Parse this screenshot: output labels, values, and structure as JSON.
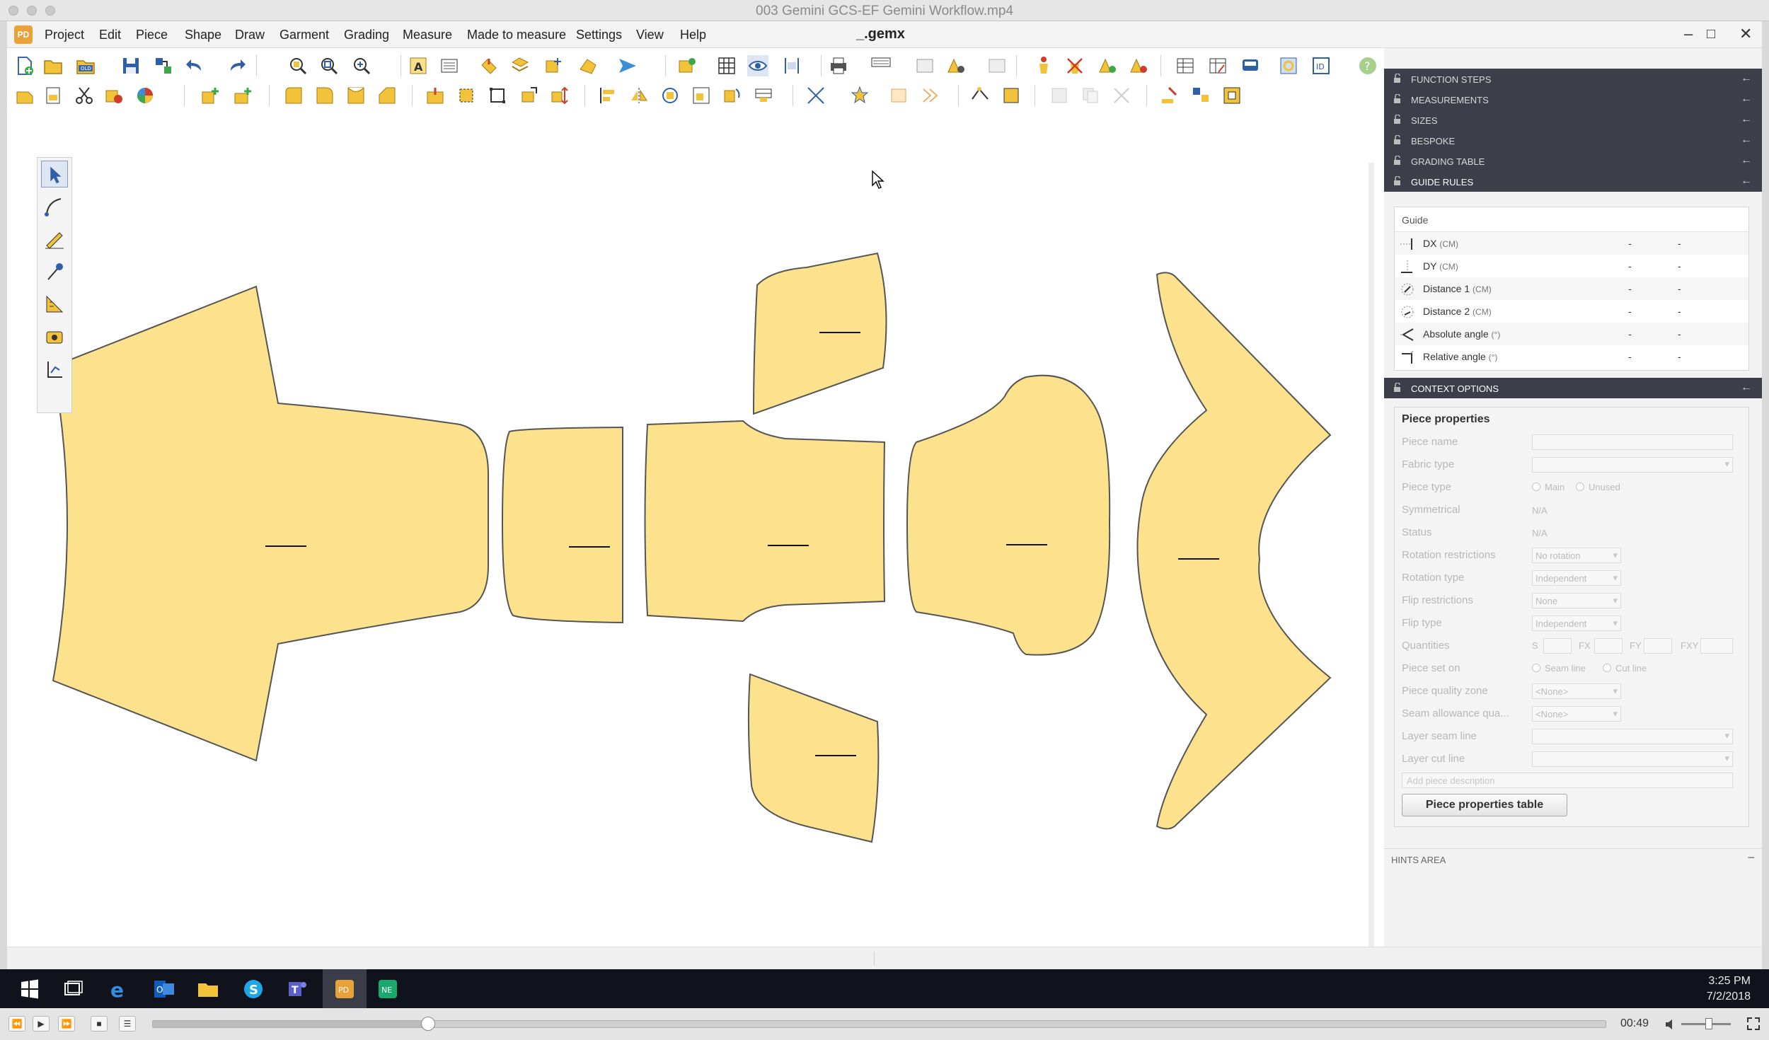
{
  "window": {
    "video_title": "003 Gemini GCS-EF Gemini Workflow.mp4",
    "document_title": "_.gemx",
    "app_logo_text": "PD"
  },
  "menu": {
    "items": [
      "Project",
      "Edit",
      "Piece",
      "Shape",
      "Draw",
      "Garment",
      "Grading",
      "Measure",
      "Made to measure",
      "Settings",
      "View",
      "Help"
    ]
  },
  "panel": {
    "sections": [
      "FUNCTION STEPS",
      "MEASUREMENTS",
      "SIZES",
      "BESPOKE",
      "GRADING TABLE",
      "GUIDE RULES"
    ],
    "guide": {
      "title": "Guide",
      "rows": [
        {
          "label": "DX",
          "unit": "(CM)",
          "v1": "-",
          "v2": "-"
        },
        {
          "label": "DY",
          "unit": "(CM)",
          "v1": "-",
          "v2": "-"
        },
        {
          "label": "Distance 1",
          "unit": "(CM)",
          "v1": "-",
          "v2": "-"
        },
        {
          "label": "Distance 2",
          "unit": "(CM)",
          "v1": "-",
          "v2": "-"
        },
        {
          "label": "Absolute angle",
          "unit": "(°)",
          "v1": "-",
          "v2": "-"
        },
        {
          "label": "Relative angle",
          "unit": "(°)",
          "v1": "-",
          "v2": "-"
        }
      ]
    },
    "context_title": "CONTEXT OPTIONS",
    "piece_properties": {
      "title": "Piece properties",
      "labels": {
        "piece_name": "Piece name",
        "fabric_type": "Fabric type",
        "piece_type": "Piece type",
        "symmetrical": "Symmetrical",
        "status": "Status",
        "rotation_restrictions": "Rotation restrictions",
        "rotation_type": "Rotation type",
        "flip_restrictions": "Flip restrictions",
        "flip_type": "Flip type",
        "quantities": "Quantities",
        "piece_set_on": "Piece set on",
        "piece_quality_zone": "Piece quality zone",
        "seam_allowance_quality": "Seam allowance qua...",
        "layer_seam_line": "Layer seam line",
        "layer_cut_line": "Layer cut line"
      },
      "values": {
        "piece_type_main": "Main",
        "piece_type_unused": "Unused",
        "symmetrical": "N/A",
        "status": "N/A",
        "rotation_restrictions": "No rotation",
        "rotation_type": "Independent",
        "flip_restrictions": "None",
        "flip_type": "Independent",
        "qty_s": "S",
        "qty_fx": "FX",
        "qty_fy": "FY",
        "qty_fxy": "FXY",
        "set_on_seam": "Seam line",
        "set_on_cut": "Cut line",
        "quality_zone": "<None>",
        "seam_quality": "<None>"
      },
      "description_placeholder": "Add piece description",
      "table_button": "Piece properties table"
    },
    "hints_title": "HINTS AREA",
    "hints_collapse": "−"
  },
  "taskbar": {
    "time": "3:25 PM",
    "date": "7/2/2018"
  },
  "video": {
    "elapsed": "00:49",
    "progress": 0.19
  },
  "colors": {
    "piece_fill": "#fce28d",
    "piece_stroke": "#555555",
    "panel_header": "#3c3f4a",
    "taskbar": "#10131c"
  }
}
